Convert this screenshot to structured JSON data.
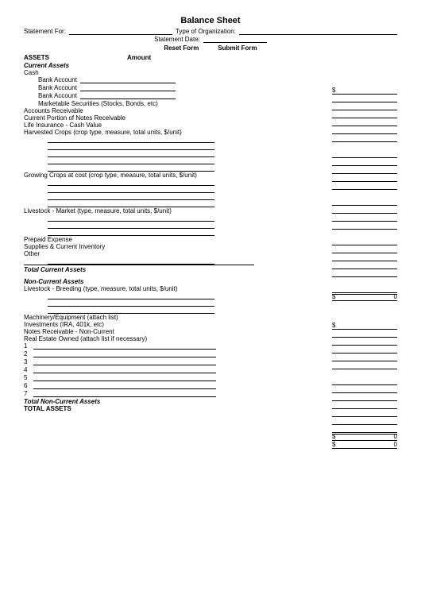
{
  "title": "Balance Sheet",
  "header": {
    "statement_for_label": "Statement For:",
    "org_type_label": "Type of Organization:",
    "statement_date_label": "Statement Date:"
  },
  "buttons": {
    "reset": "Reset Form",
    "submit": "Submit Form"
  },
  "columns": {
    "assets": "ASSETS",
    "amount": "Amount"
  },
  "current_assets": {
    "heading": "Current Assets",
    "cash": "Cash",
    "bank1": "Bank Account",
    "bank2": "Bank Account",
    "bank3": "Bank Account",
    "marketable": "Marketable Securities (Stocks, Bonds, etc)",
    "ar": "Accounts Receivable",
    "notes_current": "Current Portion of Notes Receivable",
    "life_ins": "Life Insurance - Cash Value",
    "harvested": "Harvested Crops (crop type, measure, total units, $/unit)",
    "growing": "Growing Crops at cost (crop type, measure, total units, $/unit)",
    "livestock_mkt": "Livestock - Market (type, measure, total units, $/unit)",
    "prepaid": "Prepaid Expense",
    "supplies": "Supplies & Current Inventory",
    "other": "Other",
    "total": "Total Current Assets"
  },
  "non_current_assets": {
    "heading": "Non-Current Assets",
    "livestock_breed": "Livestock - Breeding (type, measure,  total units, $/unit)",
    "machinery": "Machinery/Equipment (attach list)",
    "investments": "Investments (IRA, 401k, etc)",
    "notes_nc": "Notes Receivable - Non-Current",
    "real_estate": "Real Estate Owned (attach list if necessary)",
    "re_nums": [
      "1",
      "2",
      "3",
      "4",
      "5",
      "6",
      "7"
    ],
    "total": "Total Non-Current Assets"
  },
  "totals": {
    "total_assets": "TOTAL ASSETS",
    "dollar": "$",
    "zero": "0"
  }
}
